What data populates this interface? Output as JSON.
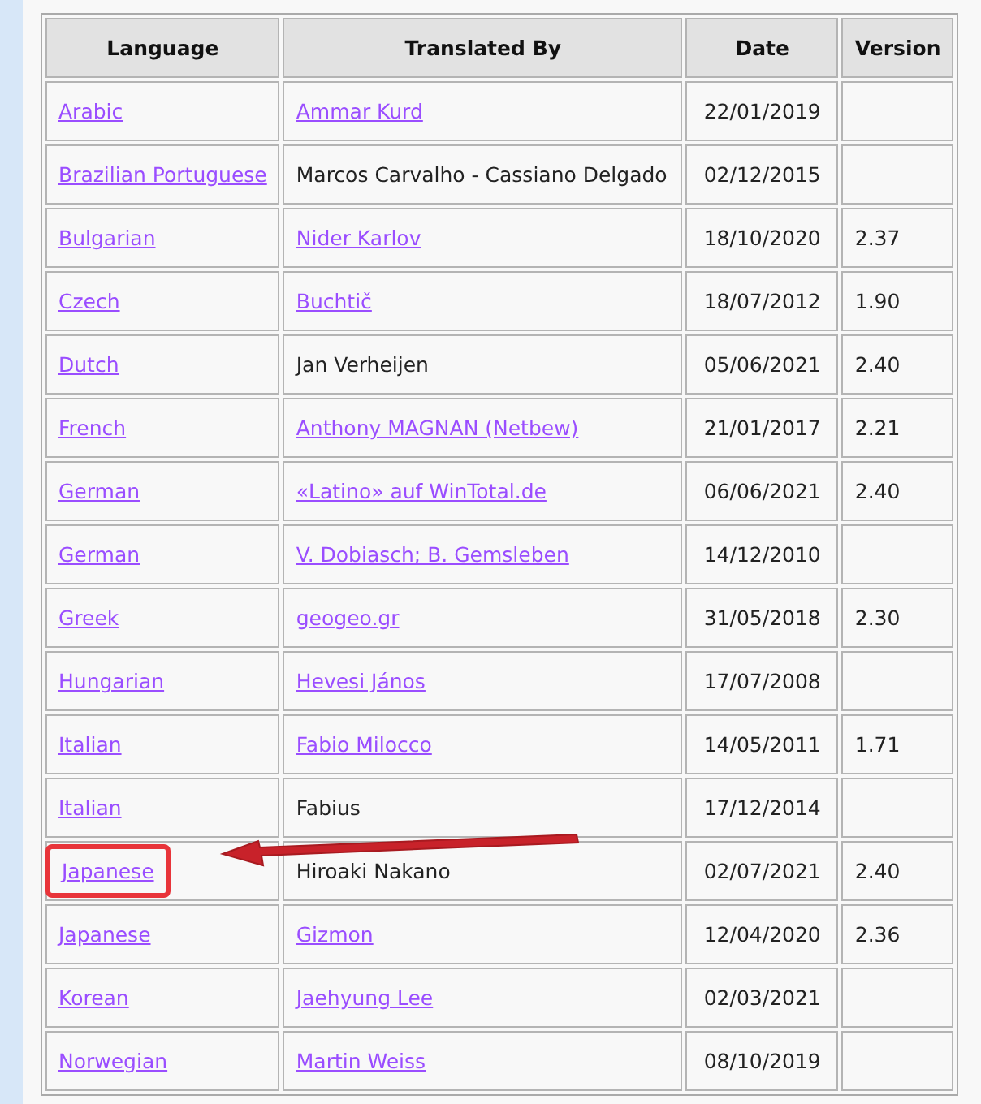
{
  "table": {
    "columns": [
      "Language",
      "Translated By",
      "Date",
      "Version"
    ],
    "rows": [
      {
        "language": "Arabic",
        "translator": "Ammar Kurd",
        "translator_link": true,
        "date": "22/01/2019",
        "version": "",
        "highlighted": false
      },
      {
        "language": "Brazilian Portuguese",
        "translator": "Marcos Carvalho - Cassiano Delgado",
        "translator_link": false,
        "date": "02/12/2015",
        "version": "",
        "highlighted": false
      },
      {
        "language": "Bulgarian",
        "translator": "Nider Karlov",
        "translator_link": true,
        "date": "18/10/2020",
        "version": "2.37",
        "highlighted": false
      },
      {
        "language": "Czech",
        "translator": "Buchtič",
        "translator_link": true,
        "date": "18/07/2012",
        "version": "1.90",
        "highlighted": false
      },
      {
        "language": "Dutch",
        "translator": "Jan Verheijen",
        "translator_link": false,
        "date": "05/06/2021",
        "version": "2.40",
        "highlighted": false
      },
      {
        "language": "French",
        "translator": "Anthony MAGNAN (Netbew)",
        "translator_link": true,
        "date": "21/01/2017",
        "version": "2.21",
        "highlighted": false
      },
      {
        "language": "German",
        "translator": "«Latino» auf WinTotal.de",
        "translator_link": true,
        "date": "06/06/2021",
        "version": "2.40",
        "highlighted": false
      },
      {
        "language": "German",
        "translator": "V. Dobiasch; B. Gemsleben",
        "translator_link": true,
        "date": "14/12/2010",
        "version": "",
        "highlighted": false
      },
      {
        "language": "Greek",
        "translator": "geogeo.gr",
        "translator_link": true,
        "date": "31/05/2018",
        "version": "2.30",
        "highlighted": false
      },
      {
        "language": "Hungarian",
        "translator": "Hevesi János",
        "translator_link": true,
        "date": "17/07/2008",
        "version": "",
        "highlighted": false
      },
      {
        "language": "Italian",
        "translator": "Fabio Milocco",
        "translator_link": true,
        "date": "14/05/2011",
        "version": "1.71",
        "highlighted": false
      },
      {
        "language": "Italian",
        "translator": "Fabius",
        "translator_link": false,
        "date": "17/12/2014",
        "version": "",
        "highlighted": false
      },
      {
        "language": "Japanese",
        "translator": "Hiroaki Nakano",
        "translator_link": false,
        "date": "02/07/2021",
        "version": "2.40",
        "highlighted": true
      },
      {
        "language": "Japanese",
        "translator": "Gizmon",
        "translator_link": true,
        "date": "12/04/2020",
        "version": "2.36",
        "highlighted": false
      },
      {
        "language": "Korean",
        "translator": "Jaehyung Lee",
        "translator_link": true,
        "date": "02/03/2021",
        "version": "",
        "highlighted": false
      },
      {
        "language": "Norwegian",
        "translator": "Martin Weiss",
        "translator_link": true,
        "date": "08/10/2019",
        "version": "",
        "highlighted": false
      }
    ]
  }
}
